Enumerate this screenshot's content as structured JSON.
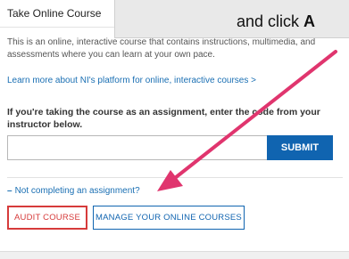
{
  "panel": {
    "title": "Take Online Course",
    "description": "This is an online, interactive course that contains instructions, multimedia, and assessments where you can learn at your own pace.",
    "learn_link": "Learn more about NI's platform for online, interactive courses >",
    "assignment_prompt": "If you're taking the course as an assignment, enter the code from your instructor below.",
    "code_input": {
      "value": "",
      "placeholder": ""
    },
    "submit_label": "SUBMIT",
    "toggle_icon": "minus-icon",
    "toggle_label": "Not completing an assignment?",
    "audit_label": "AUDIT COURSE",
    "manage_label": "MANAGE YOUR ONLINE COURSES"
  },
  "callout": {
    "text": "and click ",
    "emphasis": "A"
  },
  "colors": {
    "link": "#1a6fb3",
    "submit_bg": "#1064b0",
    "audit_border": "#d63b3b",
    "arrow": "#e0356e",
    "callout_bg": "#e9e9e9"
  }
}
